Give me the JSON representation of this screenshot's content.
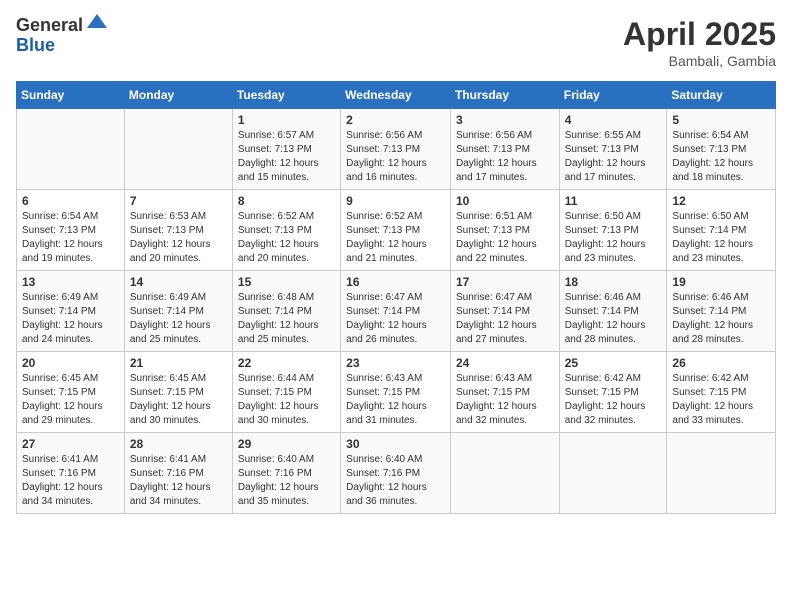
{
  "logo": {
    "general": "General",
    "blue": "Blue"
  },
  "title": {
    "month": "April 2025",
    "location": "Bambali, Gambia"
  },
  "weekdays": [
    "Sunday",
    "Monday",
    "Tuesday",
    "Wednesday",
    "Thursday",
    "Friday",
    "Saturday"
  ],
  "weeks": [
    [
      {
        "day": "",
        "info": ""
      },
      {
        "day": "",
        "info": ""
      },
      {
        "day": "1",
        "info": "Sunrise: 6:57 AM\nSunset: 7:13 PM\nDaylight: 12 hours and 15 minutes."
      },
      {
        "day": "2",
        "info": "Sunrise: 6:56 AM\nSunset: 7:13 PM\nDaylight: 12 hours and 16 minutes."
      },
      {
        "day": "3",
        "info": "Sunrise: 6:56 AM\nSunset: 7:13 PM\nDaylight: 12 hours and 17 minutes."
      },
      {
        "day": "4",
        "info": "Sunrise: 6:55 AM\nSunset: 7:13 PM\nDaylight: 12 hours and 17 minutes."
      },
      {
        "day": "5",
        "info": "Sunrise: 6:54 AM\nSunset: 7:13 PM\nDaylight: 12 hours and 18 minutes."
      }
    ],
    [
      {
        "day": "6",
        "info": "Sunrise: 6:54 AM\nSunset: 7:13 PM\nDaylight: 12 hours and 19 minutes."
      },
      {
        "day": "7",
        "info": "Sunrise: 6:53 AM\nSunset: 7:13 PM\nDaylight: 12 hours and 20 minutes."
      },
      {
        "day": "8",
        "info": "Sunrise: 6:52 AM\nSunset: 7:13 PM\nDaylight: 12 hours and 20 minutes."
      },
      {
        "day": "9",
        "info": "Sunrise: 6:52 AM\nSunset: 7:13 PM\nDaylight: 12 hours and 21 minutes."
      },
      {
        "day": "10",
        "info": "Sunrise: 6:51 AM\nSunset: 7:13 PM\nDaylight: 12 hours and 22 minutes."
      },
      {
        "day": "11",
        "info": "Sunrise: 6:50 AM\nSunset: 7:13 PM\nDaylight: 12 hours and 23 minutes."
      },
      {
        "day": "12",
        "info": "Sunrise: 6:50 AM\nSunset: 7:14 PM\nDaylight: 12 hours and 23 minutes."
      }
    ],
    [
      {
        "day": "13",
        "info": "Sunrise: 6:49 AM\nSunset: 7:14 PM\nDaylight: 12 hours and 24 minutes."
      },
      {
        "day": "14",
        "info": "Sunrise: 6:49 AM\nSunset: 7:14 PM\nDaylight: 12 hours and 25 minutes."
      },
      {
        "day": "15",
        "info": "Sunrise: 6:48 AM\nSunset: 7:14 PM\nDaylight: 12 hours and 25 minutes."
      },
      {
        "day": "16",
        "info": "Sunrise: 6:47 AM\nSunset: 7:14 PM\nDaylight: 12 hours and 26 minutes."
      },
      {
        "day": "17",
        "info": "Sunrise: 6:47 AM\nSunset: 7:14 PM\nDaylight: 12 hours and 27 minutes."
      },
      {
        "day": "18",
        "info": "Sunrise: 6:46 AM\nSunset: 7:14 PM\nDaylight: 12 hours and 28 minutes."
      },
      {
        "day": "19",
        "info": "Sunrise: 6:46 AM\nSunset: 7:14 PM\nDaylight: 12 hours and 28 minutes."
      }
    ],
    [
      {
        "day": "20",
        "info": "Sunrise: 6:45 AM\nSunset: 7:15 PM\nDaylight: 12 hours and 29 minutes."
      },
      {
        "day": "21",
        "info": "Sunrise: 6:45 AM\nSunset: 7:15 PM\nDaylight: 12 hours and 30 minutes."
      },
      {
        "day": "22",
        "info": "Sunrise: 6:44 AM\nSunset: 7:15 PM\nDaylight: 12 hours and 30 minutes."
      },
      {
        "day": "23",
        "info": "Sunrise: 6:43 AM\nSunset: 7:15 PM\nDaylight: 12 hours and 31 minutes."
      },
      {
        "day": "24",
        "info": "Sunrise: 6:43 AM\nSunset: 7:15 PM\nDaylight: 12 hours and 32 minutes."
      },
      {
        "day": "25",
        "info": "Sunrise: 6:42 AM\nSunset: 7:15 PM\nDaylight: 12 hours and 32 minutes."
      },
      {
        "day": "26",
        "info": "Sunrise: 6:42 AM\nSunset: 7:15 PM\nDaylight: 12 hours and 33 minutes."
      }
    ],
    [
      {
        "day": "27",
        "info": "Sunrise: 6:41 AM\nSunset: 7:16 PM\nDaylight: 12 hours and 34 minutes."
      },
      {
        "day": "28",
        "info": "Sunrise: 6:41 AM\nSunset: 7:16 PM\nDaylight: 12 hours and 34 minutes."
      },
      {
        "day": "29",
        "info": "Sunrise: 6:40 AM\nSunset: 7:16 PM\nDaylight: 12 hours and 35 minutes."
      },
      {
        "day": "30",
        "info": "Sunrise: 6:40 AM\nSunset: 7:16 PM\nDaylight: 12 hours and 36 minutes."
      },
      {
        "day": "",
        "info": ""
      },
      {
        "day": "",
        "info": ""
      },
      {
        "day": "",
        "info": ""
      }
    ]
  ]
}
